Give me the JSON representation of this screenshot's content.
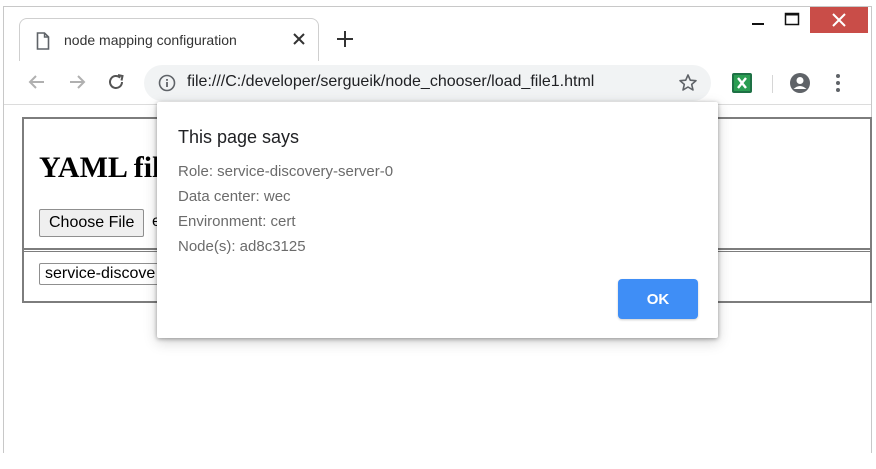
{
  "browser": {
    "tab_title": "node mapping configuration",
    "url": "file:///C:/developer/sergueik/node_chooser/load_file1.html",
    "extension_icon": "excel-extension-icon",
    "colors": {
      "close_button": "#c94d48",
      "accent": "#3f8ef6"
    }
  },
  "page": {
    "heading": "YAML fil",
    "choose_file_label": "Choose File",
    "file_name": "e",
    "select_value": "service-discove"
  },
  "dialog": {
    "title": "This page says",
    "lines": [
      "Role: service-discovery-server-0",
      "Data center: wec",
      "Environment: cert",
      "Node(s): ad8c3125"
    ],
    "ok_label": "OK"
  }
}
